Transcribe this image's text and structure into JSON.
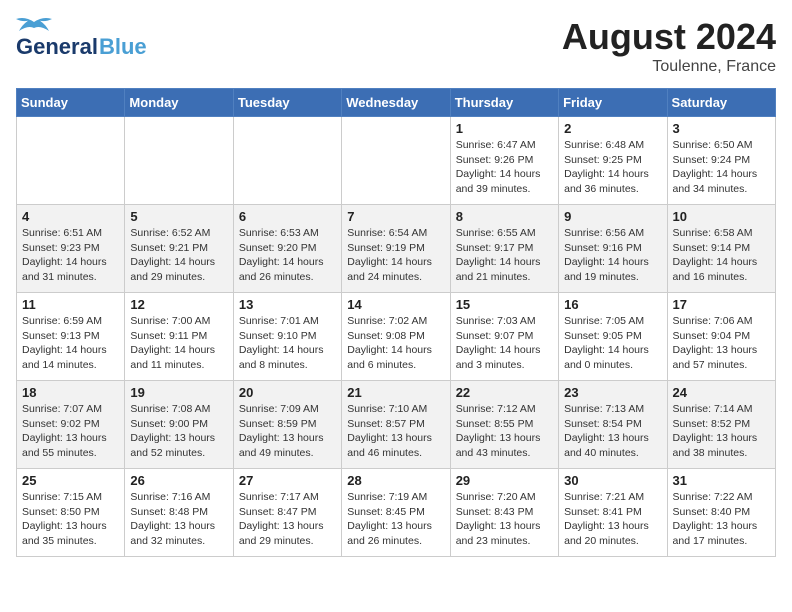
{
  "logo": {
    "line1": "General",
    "line2": "Blue"
  },
  "title": "August 2024",
  "location": "Toulenne, France",
  "days_of_week": [
    "Sunday",
    "Monday",
    "Tuesday",
    "Wednesday",
    "Thursday",
    "Friday",
    "Saturday"
  ],
  "weeks": [
    [
      {
        "day": "",
        "info": ""
      },
      {
        "day": "",
        "info": ""
      },
      {
        "day": "",
        "info": ""
      },
      {
        "day": "",
        "info": ""
      },
      {
        "day": "1",
        "info": "Sunrise: 6:47 AM\nSunset: 9:26 PM\nDaylight: 14 hours\nand 39 minutes."
      },
      {
        "day": "2",
        "info": "Sunrise: 6:48 AM\nSunset: 9:25 PM\nDaylight: 14 hours\nand 36 minutes."
      },
      {
        "day": "3",
        "info": "Sunrise: 6:50 AM\nSunset: 9:24 PM\nDaylight: 14 hours\nand 34 minutes."
      }
    ],
    [
      {
        "day": "4",
        "info": "Sunrise: 6:51 AM\nSunset: 9:23 PM\nDaylight: 14 hours\nand 31 minutes."
      },
      {
        "day": "5",
        "info": "Sunrise: 6:52 AM\nSunset: 9:21 PM\nDaylight: 14 hours\nand 29 minutes."
      },
      {
        "day": "6",
        "info": "Sunrise: 6:53 AM\nSunset: 9:20 PM\nDaylight: 14 hours\nand 26 minutes."
      },
      {
        "day": "7",
        "info": "Sunrise: 6:54 AM\nSunset: 9:19 PM\nDaylight: 14 hours\nand 24 minutes."
      },
      {
        "day": "8",
        "info": "Sunrise: 6:55 AM\nSunset: 9:17 PM\nDaylight: 14 hours\nand 21 minutes."
      },
      {
        "day": "9",
        "info": "Sunrise: 6:56 AM\nSunset: 9:16 PM\nDaylight: 14 hours\nand 19 minutes."
      },
      {
        "day": "10",
        "info": "Sunrise: 6:58 AM\nSunset: 9:14 PM\nDaylight: 14 hours\nand 16 minutes."
      }
    ],
    [
      {
        "day": "11",
        "info": "Sunrise: 6:59 AM\nSunset: 9:13 PM\nDaylight: 14 hours\nand 14 minutes."
      },
      {
        "day": "12",
        "info": "Sunrise: 7:00 AM\nSunset: 9:11 PM\nDaylight: 14 hours\nand 11 minutes."
      },
      {
        "day": "13",
        "info": "Sunrise: 7:01 AM\nSunset: 9:10 PM\nDaylight: 14 hours\nand 8 minutes."
      },
      {
        "day": "14",
        "info": "Sunrise: 7:02 AM\nSunset: 9:08 PM\nDaylight: 14 hours\nand 6 minutes."
      },
      {
        "day": "15",
        "info": "Sunrise: 7:03 AM\nSunset: 9:07 PM\nDaylight: 14 hours\nand 3 minutes."
      },
      {
        "day": "16",
        "info": "Sunrise: 7:05 AM\nSunset: 9:05 PM\nDaylight: 14 hours\nand 0 minutes."
      },
      {
        "day": "17",
        "info": "Sunrise: 7:06 AM\nSunset: 9:04 PM\nDaylight: 13 hours\nand 57 minutes."
      }
    ],
    [
      {
        "day": "18",
        "info": "Sunrise: 7:07 AM\nSunset: 9:02 PM\nDaylight: 13 hours\nand 55 minutes."
      },
      {
        "day": "19",
        "info": "Sunrise: 7:08 AM\nSunset: 9:00 PM\nDaylight: 13 hours\nand 52 minutes."
      },
      {
        "day": "20",
        "info": "Sunrise: 7:09 AM\nSunset: 8:59 PM\nDaylight: 13 hours\nand 49 minutes."
      },
      {
        "day": "21",
        "info": "Sunrise: 7:10 AM\nSunset: 8:57 PM\nDaylight: 13 hours\nand 46 minutes."
      },
      {
        "day": "22",
        "info": "Sunrise: 7:12 AM\nSunset: 8:55 PM\nDaylight: 13 hours\nand 43 minutes."
      },
      {
        "day": "23",
        "info": "Sunrise: 7:13 AM\nSunset: 8:54 PM\nDaylight: 13 hours\nand 40 minutes."
      },
      {
        "day": "24",
        "info": "Sunrise: 7:14 AM\nSunset: 8:52 PM\nDaylight: 13 hours\nand 38 minutes."
      }
    ],
    [
      {
        "day": "25",
        "info": "Sunrise: 7:15 AM\nSunset: 8:50 PM\nDaylight: 13 hours\nand 35 minutes."
      },
      {
        "day": "26",
        "info": "Sunrise: 7:16 AM\nSunset: 8:48 PM\nDaylight: 13 hours\nand 32 minutes."
      },
      {
        "day": "27",
        "info": "Sunrise: 7:17 AM\nSunset: 8:47 PM\nDaylight: 13 hours\nand 29 minutes."
      },
      {
        "day": "28",
        "info": "Sunrise: 7:19 AM\nSunset: 8:45 PM\nDaylight: 13 hours\nand 26 minutes."
      },
      {
        "day": "29",
        "info": "Sunrise: 7:20 AM\nSunset: 8:43 PM\nDaylight: 13 hours\nand 23 minutes."
      },
      {
        "day": "30",
        "info": "Sunrise: 7:21 AM\nSunset: 8:41 PM\nDaylight: 13 hours\nand 20 minutes."
      },
      {
        "day": "31",
        "info": "Sunrise: 7:22 AM\nSunset: 8:40 PM\nDaylight: 13 hours\nand 17 minutes."
      }
    ]
  ]
}
